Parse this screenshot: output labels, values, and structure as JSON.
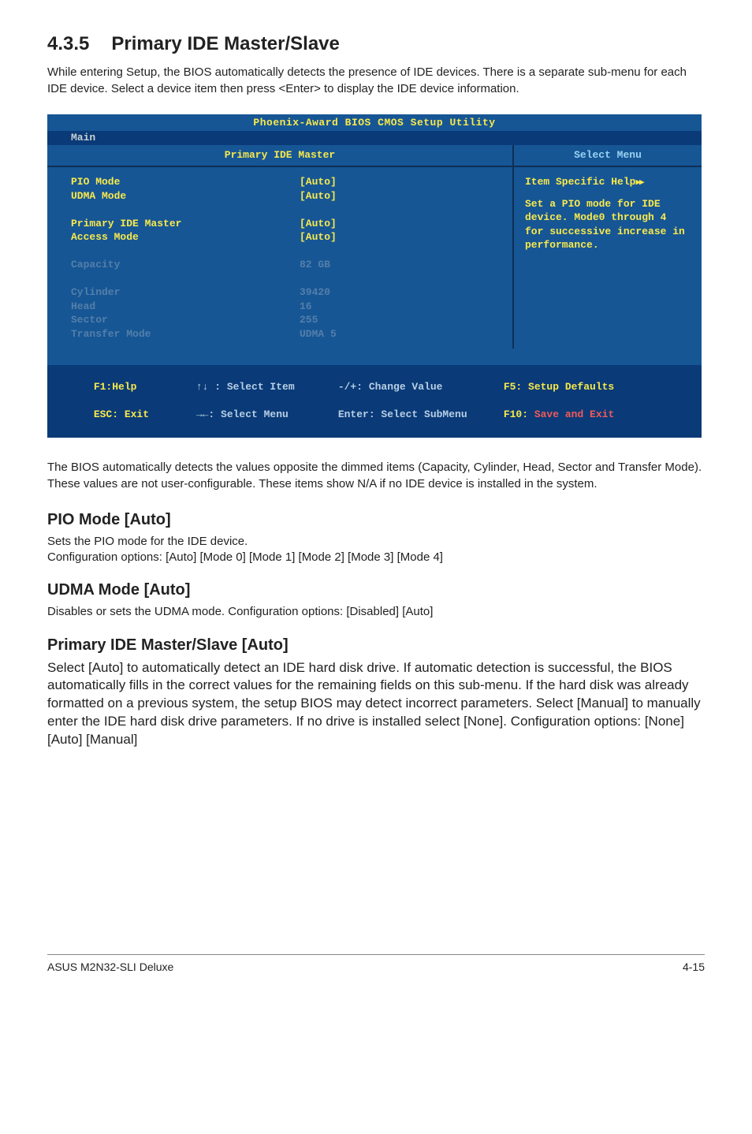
{
  "section": {
    "number": "4.3.5",
    "title": "Primary IDE Master/Slave",
    "intro": "While entering Setup, the BIOS automatically detects the presence of IDE devices. There is a separate sub-menu for each IDE device. Select a device item then press <Enter> to display the IDE device information."
  },
  "bios": {
    "title": "Phoenix-Award BIOS CMOS Setup Utility",
    "tab": "Main",
    "left_title": "Primary IDE Master",
    "right_title": "Select Menu",
    "rows": [
      {
        "label": "PIO Mode",
        "value": "[Auto]",
        "dimmed": false
      },
      {
        "label": "UDMA Mode",
        "value": "[Auto]",
        "dimmed": false
      },
      {
        "label": "",
        "value": "",
        "dimmed": false
      },
      {
        "label": "Primary IDE Master",
        "value": "[Auto]",
        "dimmed": false
      },
      {
        "label": "Access Mode",
        "value": "[Auto]",
        "dimmed": false
      },
      {
        "label": "",
        "value": "",
        "dimmed": false
      },
      {
        "label": "Capacity",
        "value": "82 GB",
        "dimmed": true
      },
      {
        "label": "",
        "value": "",
        "dimmed": false
      },
      {
        "label": "Cylinder",
        "value": "39420",
        "dimmed": true
      },
      {
        "label": "Head",
        "value": "16",
        "dimmed": true
      },
      {
        "label": "Sector",
        "value": "255",
        "dimmed": true
      },
      {
        "label": "Transfer Mode",
        "value": "UDMA 5",
        "dimmed": true
      }
    ],
    "help_title": "Item Specific Help",
    "help_body": "Set a PIO mode for IDE device. Mode0 through 4 for successive increase in performance.",
    "footer": {
      "f1": "F1:Help",
      "esc": "ESC: Exit",
      "updown": "↑↓ : Select Item",
      "leftright": "→←: Select Menu",
      "change": "-/+: Change Value",
      "enter": "Enter: Select SubMenu",
      "f5": "F5: Setup Defaults",
      "f10_prefix": "F10:",
      "f10_rest": " Save and Exit"
    }
  },
  "post_bios_paragraph": "The BIOS automatically detects the values opposite the dimmed items (Capacity, Cylinder, Head, Sector and Transfer Mode). These values are not user-configurable. These items show N/A if no IDE device is installed in the system.",
  "settings": {
    "pio": {
      "title": "PIO Mode [Auto]",
      "line1": "Sets the PIO mode for the IDE device.",
      "line2": "Configuration options: [Auto] [Mode 0] [Mode 1] [Mode 2] [Mode 3] [Mode 4]"
    },
    "udma": {
      "title": "UDMA Mode [Auto]",
      "desc": "Disables or sets the UDMA mode. Configuration options: [Disabled] [Auto]"
    },
    "primary": {
      "title": "Primary IDE Master/Slave [Auto]",
      "desc": "Select [Auto] to automatically detect an IDE hard disk drive. If automatic detection is successful, the BIOS automatically fills in the correct values for the remaining fields on this sub-menu. If the hard disk was already formatted on a previous system, the setup BIOS may detect incorrect parameters. Select [Manual] to manually enter the IDE hard disk drive parameters. If no drive is installed select [None]. Configuration options: [None] [Auto] [Manual]"
    }
  },
  "footer": {
    "left": "ASUS M2N32-SLI Deluxe",
    "right": "4-15"
  }
}
